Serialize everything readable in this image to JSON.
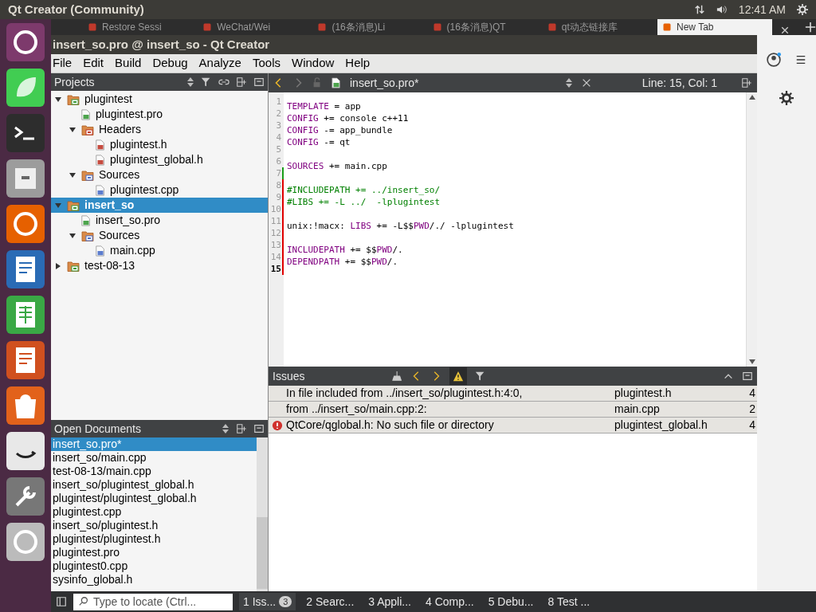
{
  "top_bar": {
    "title": "Qt Creator (Community)",
    "time": "12:41 AM"
  },
  "browser_tabs": [
    {
      "label": "Restore Sessi",
      "selected": false
    },
    {
      "label": "WeChat/Wei",
      "selected": false
    },
    {
      "label": "(16条消息)Li",
      "selected": false
    },
    {
      "label": "(16条消息)QT",
      "selected": false
    },
    {
      "label": "qt动态链接库",
      "selected": false
    },
    {
      "label": "New Tab",
      "selected": true
    }
  ],
  "window": {
    "title": "insert_so.pro @ insert_so - Qt Creator"
  },
  "menus": [
    "File",
    "Edit",
    "Build",
    "Debug",
    "Analyze",
    "Tools",
    "Window",
    "Help"
  ],
  "projects": {
    "title": "Projects",
    "tree": [
      {
        "label": "plugintest",
        "kind": "project",
        "selected": false,
        "expanded": true,
        "children": [
          {
            "label": "plugintest.pro",
            "kind": "pro",
            "selected": false
          },
          {
            "label": "Headers",
            "kind": "headers",
            "selected": false,
            "expanded": true,
            "children": [
              {
                "label": "plugintest.h",
                "kind": "h",
                "selected": false
              },
              {
                "label": "plugintest_global.h",
                "kind": "h",
                "selected": false
              }
            ]
          },
          {
            "label": "Sources",
            "kind": "sources",
            "selected": false,
            "expanded": true,
            "children": [
              {
                "label": "plugintest.cpp",
                "kind": "cpp",
                "selected": false
              }
            ]
          }
        ]
      },
      {
        "label": "insert_so",
        "kind": "project",
        "selected": true,
        "expanded": true,
        "children": [
          {
            "label": "insert_so.pro",
            "kind": "pro",
            "selected": false
          },
          {
            "label": "Sources",
            "kind": "sources",
            "selected": false,
            "expanded": true,
            "children": [
              {
                "label": "main.cpp",
                "kind": "cpp",
                "selected": false
              }
            ]
          }
        ]
      },
      {
        "label": "test-08-13",
        "kind": "project",
        "selected": false,
        "expanded": false
      }
    ]
  },
  "open_documents": {
    "title": "Open Documents",
    "items": [
      {
        "label": "insert_so.pro*",
        "selected": true
      },
      {
        "label": "insert_so/main.cpp",
        "selected": false
      },
      {
        "label": "test-08-13/main.cpp",
        "selected": false
      },
      {
        "label": "insert_so/plugintest_global.h",
        "selected": false
      },
      {
        "label": "plugintest/plugintest_global.h",
        "selected": false
      },
      {
        "label": "plugintest.cpp",
        "selected": false
      },
      {
        "label": "insert_so/plugintest.h",
        "selected": false
      },
      {
        "label": "plugintest/plugintest.h",
        "selected": false
      },
      {
        "label": "plugintest.pro",
        "selected": false
      },
      {
        "label": "plugintest0.cpp",
        "selected": false
      },
      {
        "label": "sysinfo_global.h",
        "selected": false
      }
    ]
  },
  "editor": {
    "file": "insert_so.pro*",
    "position": "Line: 15, Col: 1",
    "lines": [
      {
        "number": "1",
        "current": false,
        "tokens": [
          {
            "text": "TEMPLATE",
            "kind": "keyword"
          },
          {
            "text": " = app",
            "kind": "plain"
          }
        ]
      },
      {
        "number": "2",
        "current": false,
        "tokens": [
          {
            "text": "CONFIG",
            "kind": "keyword"
          },
          {
            "text": " += console c++11",
            "kind": "plain"
          }
        ]
      },
      {
        "number": "3",
        "current": false,
        "tokens": [
          {
            "text": "CONFIG",
            "kind": "keyword"
          },
          {
            "text": " -= app_bundle",
            "kind": "plain"
          }
        ]
      },
      {
        "number": "4",
        "current": false,
        "tokens": [
          {
            "text": "CONFIG",
            "kind": "keyword"
          },
          {
            "text": " -= qt",
            "kind": "plain"
          }
        ]
      },
      {
        "number": "5",
        "current": false
      },
      {
        "number": "6",
        "current": false,
        "tokens": [
          {
            "text": "SOURCES",
            "kind": "keyword"
          },
          {
            "text": " += main.cpp",
            "kind": "plain"
          }
        ]
      },
      {
        "number": "7",
        "kind": "added",
        "current": false
      },
      {
        "number": "8",
        "kind": "modified",
        "current": false,
        "tokens": [
          {
            "text": "#INCLUDEPATH += ../insert_so/",
            "kind": "comment"
          }
        ]
      },
      {
        "number": "9",
        "kind": "modified",
        "current": false,
        "tokens": [
          {
            "text": "#LIBS += -L ../  -lplugintest",
            "kind": "comment"
          }
        ]
      },
      {
        "number": "10",
        "kind": "modified",
        "current": false
      },
      {
        "number": "11",
        "kind": "modified",
        "current": false,
        "tokens": [
          {
            "text": "unix:!macx: ",
            "kind": "plain"
          },
          {
            "text": "LIBS",
            "kind": "keyword"
          },
          {
            "text": " += -L$$",
            "kind": "plain"
          },
          {
            "text": "PWD",
            "kind": "keyword"
          },
          {
            "text": "/./ -lplugintest",
            "kind": "plain"
          }
        ]
      },
      {
        "number": "12",
        "kind": "modified",
        "current": false
      },
      {
        "number": "13",
        "kind": "modified",
        "current": false,
        "tokens": [
          {
            "text": "INCLUDEPATH",
            "kind": "keyword"
          },
          {
            "text": " += $$",
            "kind": "plain"
          },
          {
            "text": "PWD",
            "kind": "keyword"
          },
          {
            "text": "/.",
            "kind": "plain"
          }
        ]
      },
      {
        "number": "14",
        "kind": "modified",
        "current": false,
        "tokens": [
          {
            "text": "DEPENDPATH",
            "kind": "keyword"
          },
          {
            "text": " += $$",
            "kind": "plain"
          },
          {
            "text": "PWD",
            "kind": "keyword"
          },
          {
            "text": "/.",
            "kind": "plain"
          }
        ]
      },
      {
        "number": "15",
        "kind": "modified",
        "current": true
      }
    ]
  },
  "issues": {
    "title": "Issues",
    "rows": [
      {
        "message": "In file included from ../insert_so/plugintest.h:4:0,",
        "file": "plugintest.h",
        "line": "4"
      },
      {
        "message": "from ../insert_so/main.cpp:2:",
        "file": "main.cpp",
        "line": "2"
      },
      {
        "message": "QtCore/qglobal.h: No such file or directory",
        "file": "plugintest_global.h",
        "line": "4",
        "kind": "error"
      }
    ]
  },
  "status_bar": {
    "locator_placeholder": "Type to locate (Ctrl...",
    "panes": [
      {
        "label": "1 Iss...",
        "badge": "3",
        "selected": true
      },
      {
        "label": "2 Searc...",
        "selected": false
      },
      {
        "label": "3 Appli...",
        "selected": false
      },
      {
        "label": "4 Comp...",
        "selected": false
      },
      {
        "label": "5 Debu...",
        "selected": false
      },
      {
        "label": "8 Test ...",
        "selected": false
      }
    ]
  }
}
